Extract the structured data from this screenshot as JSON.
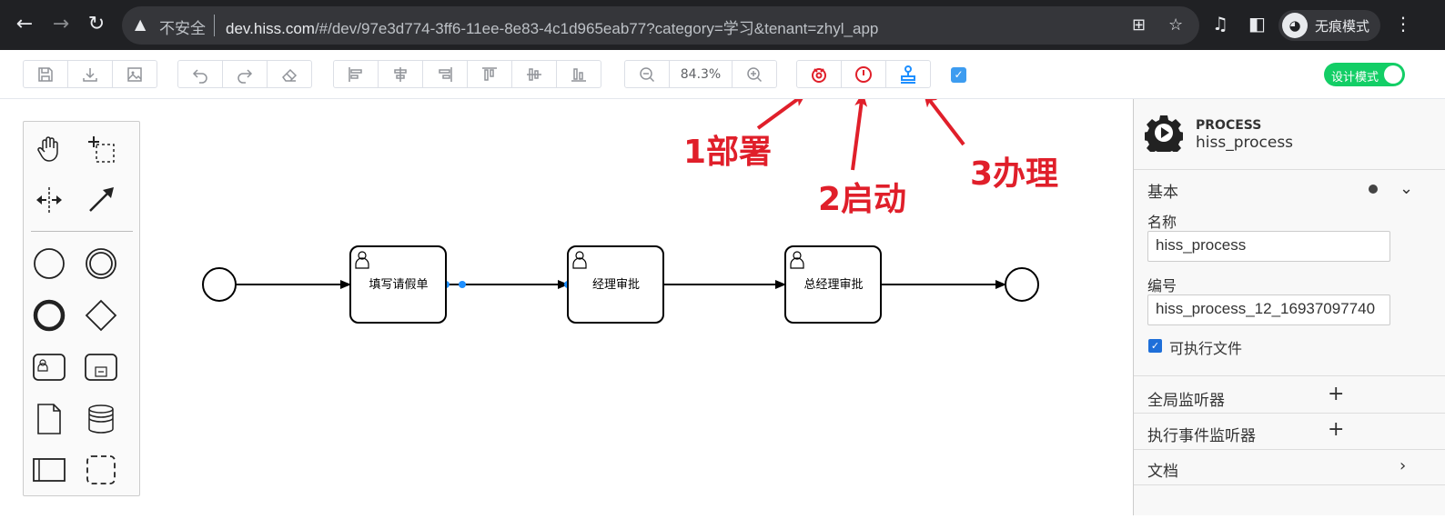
{
  "browser": {
    "security_label": "不安全",
    "url_host": "dev.hiss.com",
    "url_rest": "/#/dev/97e3d774-3ff6-11ee-8e83-4c1d965eab77?category=学习&tenant=zhyl_app",
    "profile_label": "无痕模式"
  },
  "toolbar": {
    "zoom": "84.3%",
    "design_mode_label": "设计模式"
  },
  "annotations": {
    "deploy": "1部署",
    "start": "2启动",
    "handle": "3办理"
  },
  "diagram": {
    "tasks": [
      "填写请假单",
      "经理审批",
      "总经理审批"
    ]
  },
  "panel": {
    "type": "PROCESS",
    "name": "hiss_process",
    "section_basic": "基本",
    "label_name": "名称",
    "value_name": "hiss_process",
    "label_id": "编号",
    "value_id": "hiss_process_12_16937097740",
    "executable_label": "可执行文件",
    "global_listeners": "全局监听器",
    "execution_listeners": "执行事件监听器",
    "documentation": "文档"
  },
  "colors": {
    "accent_red": "#e01f2a",
    "accent_blue": "#1e8fff",
    "switch_green": "#13ce66"
  }
}
